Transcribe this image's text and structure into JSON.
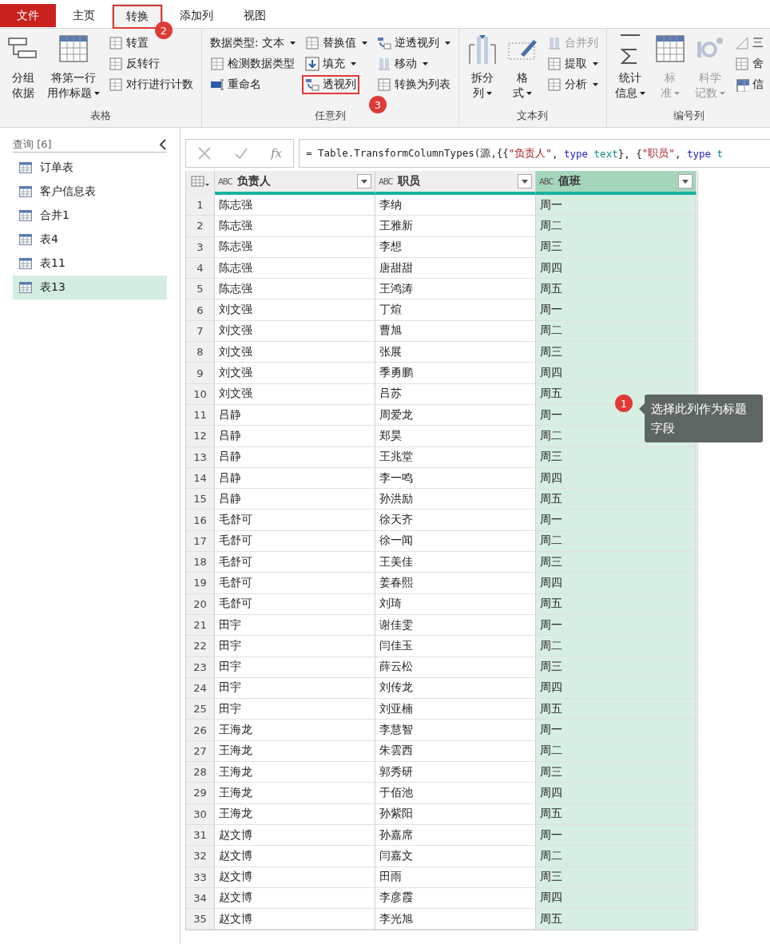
{
  "tabs": [
    {
      "label": "文件",
      "kind": "file",
      "selected": false
    },
    {
      "label": "主页",
      "kind": "tab",
      "selected": false
    },
    {
      "label": "转换",
      "kind": "tab",
      "selected": true,
      "callout": "2"
    },
    {
      "label": "添加列",
      "kind": "tab",
      "selected": false
    },
    {
      "label": "视图",
      "kind": "tab",
      "selected": false
    }
  ],
  "ribbon": {
    "groups": [
      {
        "title": "表格",
        "columns": [
          {
            "kind": "large",
            "items": [
              {
                "lines": [
                  "分组",
                  "依据"
                ],
                "dropdown": false,
                "disabled": false
              }
            ]
          },
          {
            "kind": "large",
            "items": [
              {
                "lines": [
                  "将第一行",
                  "用作标题"
                ],
                "dropdown": true,
                "disabled": false
              }
            ]
          },
          {
            "kind": "small",
            "items": [
              {
                "label": "转置",
                "dropdown": false,
                "disabled": false
              },
              {
                "label": "反转行",
                "dropdown": false,
                "disabled": false
              },
              {
                "label": "对行进行计数",
                "dropdown": false,
                "disabled": false
              }
            ]
          }
        ]
      },
      {
        "title": "任意列",
        "columns": [
          {
            "kind": "small",
            "items": [
              {
                "label": "数据类型: 文本",
                "dropdown": true,
                "disabled": false
              },
              {
                "label": "检测数据类型",
                "dropdown": false,
                "disabled": false
              },
              {
                "label": "重命名",
                "dropdown": false,
                "disabled": false
              }
            ]
          },
          {
            "kind": "small",
            "items": [
              {
                "label": "替换值",
                "dropdown": true,
                "disabled": false
              },
              {
                "label": "填充",
                "dropdown": true,
                "disabled": false
              },
              {
                "label": "透视列",
                "dropdown": false,
                "disabled": false,
                "callout": "3"
              }
            ]
          },
          {
            "kind": "small",
            "items": [
              {
                "label": "逆透视列",
                "dropdown": true,
                "disabled": false
              },
              {
                "label": "移动",
                "dropdown": true,
                "disabled": false
              },
              {
                "label": "转换为列表",
                "dropdown": false,
                "disabled": false
              }
            ]
          }
        ]
      },
      {
        "title": "文本列",
        "columns": [
          {
            "kind": "large",
            "items": [
              {
                "lines": [
                  "拆分",
                  "列"
                ],
                "dropdown": true,
                "disabled": false
              }
            ]
          },
          {
            "kind": "large",
            "items": [
              {
                "lines": [
                  "格",
                  "式"
                ],
                "dropdown": true,
                "disabled": false
              }
            ]
          },
          {
            "kind": "small",
            "items": [
              {
                "label": "合并列",
                "dropdown": false,
                "disabled": true
              },
              {
                "label": "提取",
                "dropdown": true,
                "disabled": false
              },
              {
                "label": "分析",
                "dropdown": true,
                "disabled": false
              }
            ]
          }
        ]
      },
      {
        "title": "编号列",
        "columns": [
          {
            "kind": "large",
            "items": [
              {
                "lines": [
                  "统计",
                  "信息"
                ],
                "dropdown": true,
                "disabled": false
              }
            ]
          },
          {
            "kind": "large",
            "items": [
              {
                "lines": [
                  "标",
                  "准"
                ],
                "dropdown": true,
                "disabled": true
              }
            ]
          },
          {
            "kind": "large",
            "items": [
              {
                "lines": [
                  "科学",
                  "记数"
                ],
                "dropdown": true,
                "disabled": true
              }
            ]
          },
          {
            "kind": "small",
            "items": [
              {
                "label": "三",
                "dropdown": false,
                "disabled": false
              },
              {
                "label": "舍",
                "dropdown": false,
                "disabled": false
              },
              {
                "label": "信",
                "dropdown": false,
                "disabled": false
              }
            ]
          }
        ]
      }
    ]
  },
  "sidebar": {
    "title": "查询 [6]",
    "items": [
      {
        "label": "订单表",
        "selected": false
      },
      {
        "label": "客户信息表",
        "selected": false
      },
      {
        "label": "合并1",
        "selected": false
      },
      {
        "label": "表4",
        "selected": false
      },
      {
        "label": "表11",
        "selected": false
      },
      {
        "label": "表13",
        "selected": true
      }
    ]
  },
  "formula_bar": {
    "fx": "fx",
    "tokens": [
      {
        "kind": "plain",
        "text": "= Table.TransformColumnTypes(源,{{"
      },
      {
        "kind": "string",
        "text": "\"负责人\""
      },
      {
        "kind": "plain",
        "text": ", "
      },
      {
        "kind": "keyword",
        "text": "type "
      },
      {
        "kind": "typename",
        "text": "text"
      },
      {
        "kind": "plain",
        "text": "}, {"
      },
      {
        "kind": "string",
        "text": "\"职员\""
      },
      {
        "kind": "plain",
        "text": ", "
      },
      {
        "kind": "keyword",
        "text": "type "
      },
      {
        "kind": "typename",
        "text": "t"
      }
    ]
  },
  "table": {
    "columns": [
      {
        "name": "负责人",
        "type": "ABC",
        "selected": false
      },
      {
        "name": "职员",
        "type": "ABC",
        "selected": false
      },
      {
        "name": "值班",
        "type": "ABC",
        "selected": true
      }
    ],
    "rows": [
      {
        "n": "1",
        "cells": [
          "陈志强",
          "李纳",
          "周一"
        ]
      },
      {
        "n": "2",
        "cells": [
          "陈志强",
          "王雅新",
          "周二"
        ]
      },
      {
        "n": "3",
        "cells": [
          "陈志强",
          "李想",
          "周三"
        ]
      },
      {
        "n": "4",
        "cells": [
          "陈志强",
          "唐甜甜",
          "周四"
        ]
      },
      {
        "n": "5",
        "cells": [
          "陈志强",
          "王鸿涛",
          "周五"
        ]
      },
      {
        "n": "6",
        "cells": [
          "刘文强",
          "丁煊",
          "周一"
        ]
      },
      {
        "n": "7",
        "cells": [
          "刘文强",
          "曹旭",
          "周二"
        ]
      },
      {
        "n": "8",
        "cells": [
          "刘文强",
          "张展",
          "周三"
        ]
      },
      {
        "n": "9",
        "cells": [
          "刘文强",
          "季勇鹏",
          "周四"
        ]
      },
      {
        "n": "10",
        "cells": [
          "刘文强",
          "吕苏",
          "周五"
        ]
      },
      {
        "n": "11",
        "cells": [
          "吕静",
          "周爱龙",
          "周一"
        ]
      },
      {
        "n": "12",
        "cells": [
          "吕静",
          "郑昊",
          "周二"
        ]
      },
      {
        "n": "13",
        "cells": [
          "吕静",
          "王兆堂",
          "周三"
        ]
      },
      {
        "n": "14",
        "cells": [
          "吕静",
          "李一鸣",
          "周四"
        ]
      },
      {
        "n": "15",
        "cells": [
          "吕静",
          "孙洪励",
          "周五"
        ]
      },
      {
        "n": "16",
        "cells": [
          "毛舒可",
          "徐天齐",
          "周一"
        ]
      },
      {
        "n": "17",
        "cells": [
          "毛舒可",
          "徐一闻",
          "周二"
        ]
      },
      {
        "n": "18",
        "cells": [
          "毛舒可",
          "王美佳",
          "周三"
        ]
      },
      {
        "n": "19",
        "cells": [
          "毛舒可",
          "姜春熙",
          "周四"
        ]
      },
      {
        "n": "20",
        "cells": [
          "毛舒可",
          "刘琦",
          "周五"
        ]
      },
      {
        "n": "21",
        "cells": [
          "田宇",
          "谢佳雯",
          "周一"
        ]
      },
      {
        "n": "22",
        "cells": [
          "田宇",
          "闫佳玉",
          "周二"
        ]
      },
      {
        "n": "23",
        "cells": [
          "田宇",
          "薛云松",
          "周三"
        ]
      },
      {
        "n": "24",
        "cells": [
          "田宇",
          "刘传龙",
          "周四"
        ]
      },
      {
        "n": "25",
        "cells": [
          "田宇",
          "刘亚楠",
          "周五"
        ]
      },
      {
        "n": "26",
        "cells": [
          "王海龙",
          "李慧智",
          "周一"
        ]
      },
      {
        "n": "27",
        "cells": [
          "王海龙",
          "朱雲西",
          "周二"
        ]
      },
      {
        "n": "28",
        "cells": [
          "王海龙",
          "郭秀研",
          "周三"
        ]
      },
      {
        "n": "29",
        "cells": [
          "王海龙",
          "于佰池",
          "周四"
        ]
      },
      {
        "n": "30",
        "cells": [
          "王海龙",
          "孙紫阳",
          "周五"
        ]
      },
      {
        "n": "31",
        "cells": [
          "赵文博",
          "孙嘉席",
          "周一"
        ]
      },
      {
        "n": "32",
        "cells": [
          "赵文博",
          "闫嘉文",
          "周二"
        ]
      },
      {
        "n": "33",
        "cells": [
          "赵文博",
          "田雨",
          "周三"
        ]
      },
      {
        "n": "34",
        "cells": [
          "赵文博",
          "李彦霞",
          "周四"
        ]
      },
      {
        "n": "35",
        "cells": [
          "赵文博",
          "李光旭",
          "周五"
        ]
      }
    ]
  },
  "tooltip": {
    "callout": "1",
    "text": "选择此列作为标题字段"
  }
}
